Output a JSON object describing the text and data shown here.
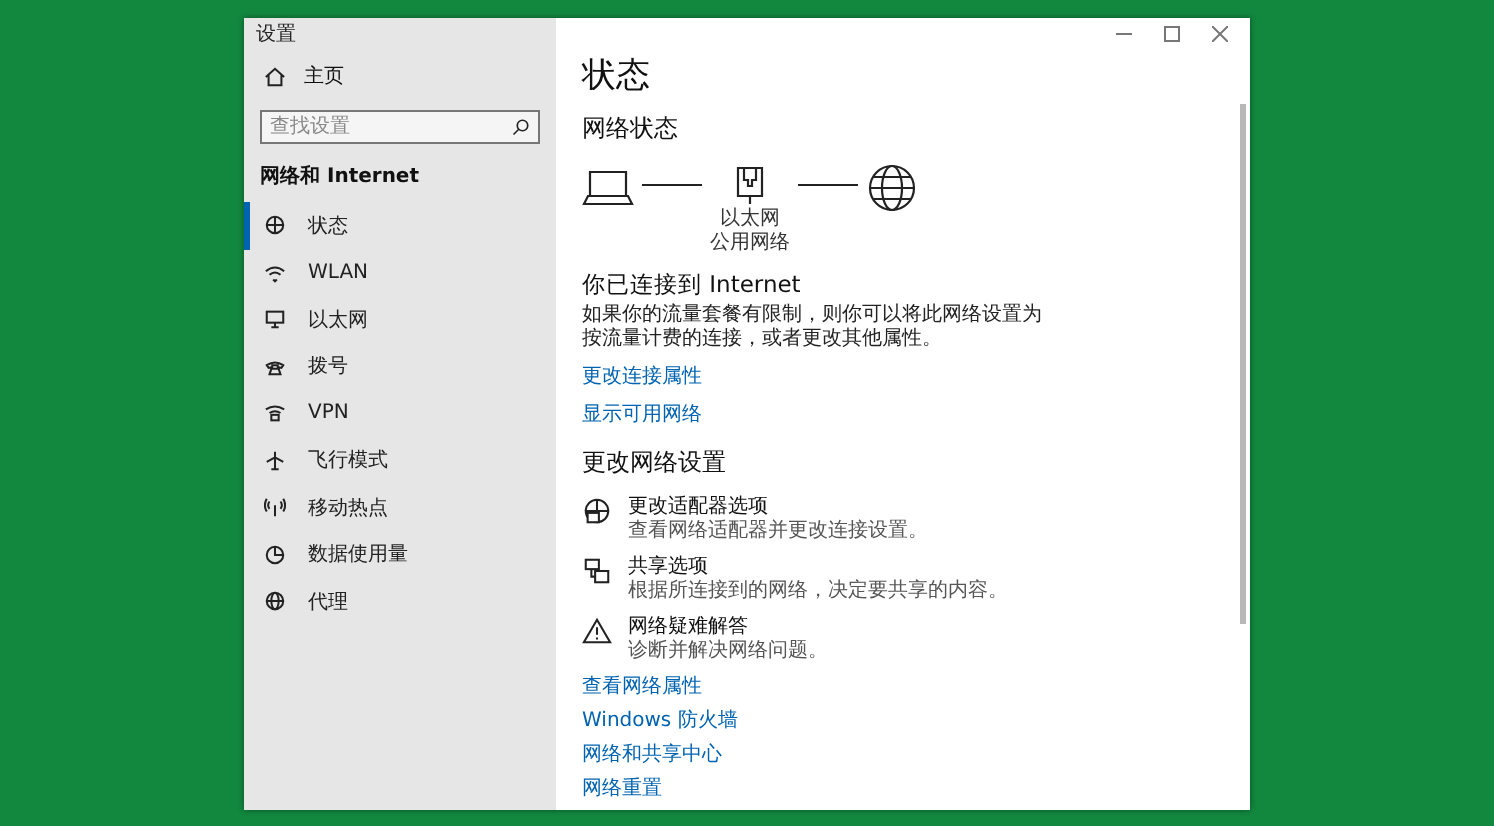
{
  "window": {
    "title": "设置"
  },
  "sidebar": {
    "home": "主页",
    "search": {
      "placeholder": "查找设置"
    },
    "section": "网络和 Internet",
    "items": [
      {
        "label": "状态",
        "kind": "status",
        "selected": true
      },
      {
        "label": "WLAN",
        "kind": "wlan",
        "selected": false
      },
      {
        "label": "以太网",
        "kind": "ethernet",
        "selected": false
      },
      {
        "label": "拨号",
        "kind": "dialup",
        "selected": false
      },
      {
        "label": "VPN",
        "kind": "vpn",
        "selected": false
      },
      {
        "label": "飞行模式",
        "kind": "airplane",
        "selected": false
      },
      {
        "label": "移动热点",
        "kind": "hotspot",
        "selected": false
      },
      {
        "label": "数据使用量",
        "kind": "data",
        "selected": false
      },
      {
        "label": "代理",
        "kind": "proxy",
        "selected": false
      }
    ]
  },
  "content": {
    "title": "状态",
    "network_status": {
      "heading": "网络状态",
      "adapter_label": "以太网",
      "network_type": "公用网络"
    },
    "connected": {
      "heading": "你已连接到 Internet",
      "description": "如果你的流量套餐有限制，则你可以将此网络设置为按流量计费的连接，或者更改其他属性。"
    },
    "links": [
      "更改连接属性",
      "显示可用网络"
    ],
    "change_heading": "更改网络设置",
    "options": [
      {
        "kind": "adapter",
        "title": "更改适配器选项",
        "description": "查看网络适配器并更改连接设置。"
      },
      {
        "kind": "sharing",
        "title": "共享选项",
        "description": "根据所连接到的网络，决定要共享的内容。"
      },
      {
        "kind": "troubleshoot",
        "title": "网络疑难解答",
        "description": "诊断并解决网络问题。"
      }
    ],
    "bottom_links": [
      "查看网络属性",
      "Windows 防火墙",
      "网络和共享中心",
      "网络重置"
    ]
  }
}
